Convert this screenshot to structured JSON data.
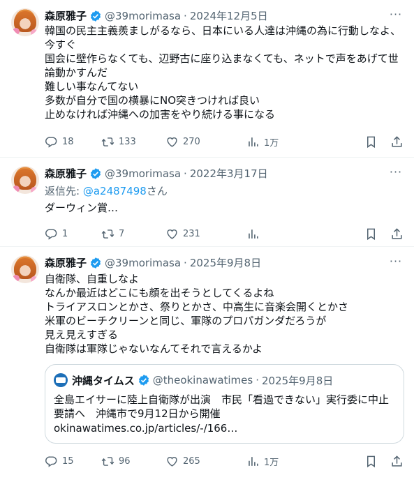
{
  "tweets": [
    {
      "name": "森原雅子",
      "handle": "@39morimasa",
      "sep": "·",
      "date": "2024年12月5日",
      "text": "韓国の民主主義羨ましがるなら、日本にいる人達は沖縄の為に行動しなよ、\n今すぐ\n国会に壁作らなくても、辺野古に座り込まなくても、ネットで声をあげて世\n論動かすんだ\n難しい事なんてない\n多数が自分で国の横暴にNO突きつければ良い\n止めなければ沖縄への加害をやり続ける事になる",
      "replies": "18",
      "reposts": "133",
      "likes": "270",
      "views": "1万"
    },
    {
      "name": "森原雅子",
      "handle": "@39morimasa",
      "sep": "·",
      "date": "2022年3月17日",
      "reply_prefix": "返信先: ",
      "reply_to": "@a2487498",
      "reply_suffix": "さん",
      "text": "ダーウィン賞…",
      "replies": "1",
      "reposts": "7",
      "likes": "231",
      "views": ""
    },
    {
      "name": "森原雅子",
      "handle": "@39morimasa",
      "sep": "·",
      "date": "2025年9月8日",
      "text": "自衛隊、自重しなよ\nなんか最近はどこにも顔を出そうとしてくるよね\nトライアスロンとかさ、祭りとかさ、中高生に音楽会開くとかさ\n米軍のビーチクリーンと同じ、軍隊のプロパガンダだろうが\n見え見えすぎる\n自衛隊は軍隊じゃないなんてそれで言えるかよ",
      "quote": {
        "name": "沖縄タイムス",
        "handle": "@theokinawatimes",
        "sep": "·",
        "date": "2025年9月8日",
        "text": "全島エイサーに陸上自衛隊が出演　市民「看過できない」実行委に中止要請へ　沖縄市で9月12日から開催",
        "link": "okinawatimes.co.jp/articles/-/166…"
      },
      "replies": "15",
      "reposts": "96",
      "likes": "265",
      "views": "1万"
    }
  ],
  "more_glyph": "···",
  "colors": {
    "verified": "#1d9bf0",
    "secondary": "#536471",
    "link": "#1d9bf0"
  },
  "icons": [
    "reply-icon",
    "repost-icon",
    "like-icon",
    "views-icon",
    "bookmark-icon",
    "share-icon",
    "verified-icon",
    "more-icon"
  ]
}
